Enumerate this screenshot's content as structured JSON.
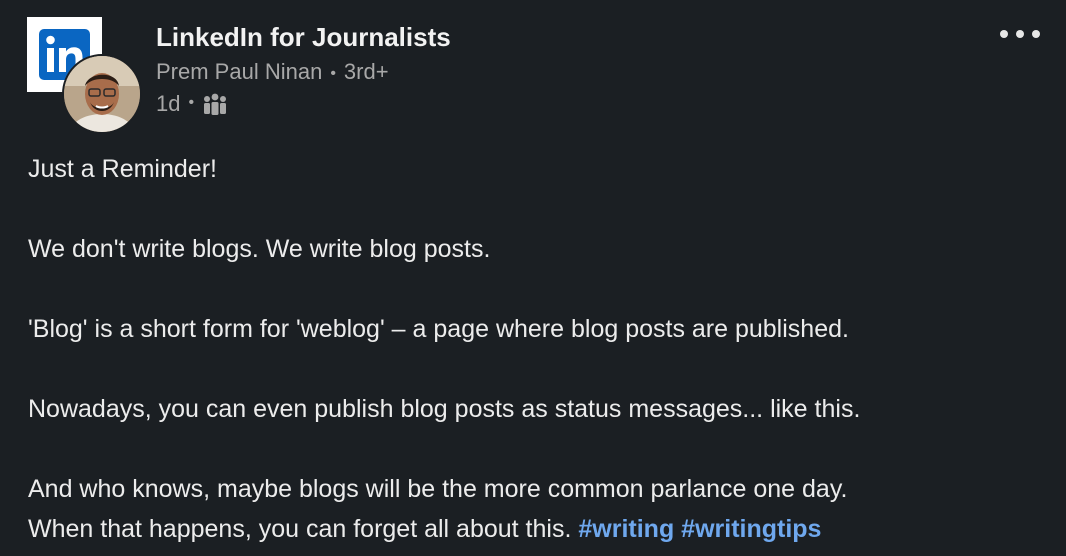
{
  "post": {
    "group_name": "LinkedIn for Journalists",
    "author": "Prem Paul Ninan",
    "connection_degree": "3rd+",
    "time_ago": "1d",
    "visibility_icon": "group-people-icon",
    "more_icon": "more-options-icon",
    "logo_text": "in",
    "paragraphs": {
      "p1": "Just a Reminder!",
      "p2": "We don't write blogs. We write blog posts.",
      "p3": "'Blog' is a short form for 'weblog' – a page where blog posts are published.",
      "p4": "Nowadays, you can even publish blog posts as status messages... like this.",
      "p5_line1": "And who knows, maybe blogs will be the more common parlance one day.",
      "p5_line2": "When that happens, you can forget all about this."
    },
    "hashtags": [
      "#writing",
      "#writingtips"
    ]
  },
  "colors": {
    "background": "#1b1f23",
    "text": "#ececec",
    "muted": "#a8a8a8",
    "hashtag": "#6fa8ee",
    "brand": "#0a66c2"
  },
  "separator": "•"
}
